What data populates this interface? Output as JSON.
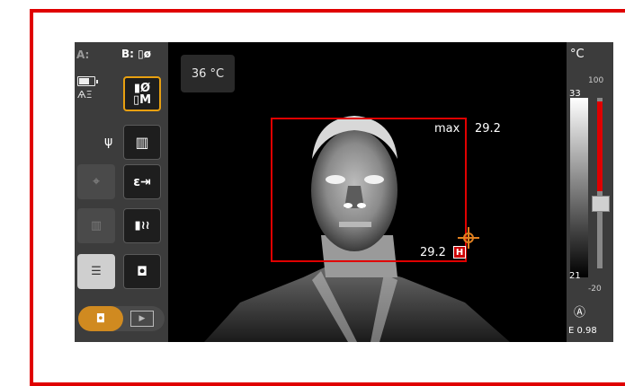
{
  "left": {
    "label_a": "A:",
    "label_b": "B:",
    "label_b_icon": "thermometer-icon",
    "icons": [
      "battery-icon",
      "no-focus-icon",
      "usb-icon"
    ],
    "tools": [
      {
        "name": "temp-measure-button",
        "glyph": "Ø\nM"
      },
      {
        "name": "scale-button",
        "glyph": "▥"
      },
      {
        "name": "emissivity-button",
        "glyph": "ε↗"
      },
      {
        "name": "reflected-temp-button",
        "glyph": "≀≀"
      },
      {
        "name": "photo-button",
        "glyph": "◘"
      }
    ],
    "mode_photo_glyph": "◘",
    "mode_video_glyph": "▶"
  },
  "image": {
    "spot_temp": "36 °C",
    "max_label": "max",
    "max_value": "29.2",
    "hot_value": "29.2",
    "hot_badge": "H"
  },
  "scale": {
    "unit": "°C",
    "tick_top": "100",
    "hi": "33",
    "lo": "21",
    "tick_bottom": "-20",
    "auto": "Ⓐ",
    "emissivity": "E 0.98"
  },
  "colors": {
    "accent_orange": "#e8a010",
    "roi_red": "#e00000",
    "frame_red": "#e00000"
  }
}
